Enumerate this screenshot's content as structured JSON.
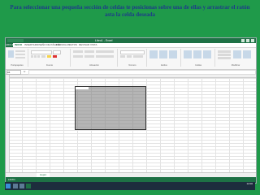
{
  "slide": {
    "title": "Para seleccionar una pequeña sección de celdas te posicionas sobre una de ellas y arrastrar el ratón asta la celda deseada"
  },
  "excel": {
    "window_title": "Libro1 - Excel",
    "tabs": [
      "ARCHIVO",
      "INICIO",
      "INSERTAR",
      "DISEÑO DE PÁGINA",
      "FÓRMULAS",
      "DATOS",
      "REVISAR",
      "VISTA"
    ],
    "active_tab": "INICIO",
    "ribbon_groups": [
      "Portapapeles",
      "Fuente",
      "Alineación",
      "Número",
      "Estilos",
      "Celdas",
      "Modificar"
    ],
    "name_box": "A1",
    "formula_label": "fx",
    "sheet_tab": "Hoja1",
    "status_text": "LISTO"
  },
  "taskbar": {
    "clock": "12:00"
  },
  "colors": {
    "background": "#1f9a4a",
    "excel_green": "#1e7145",
    "title_text": "#1f3a8a"
  }
}
